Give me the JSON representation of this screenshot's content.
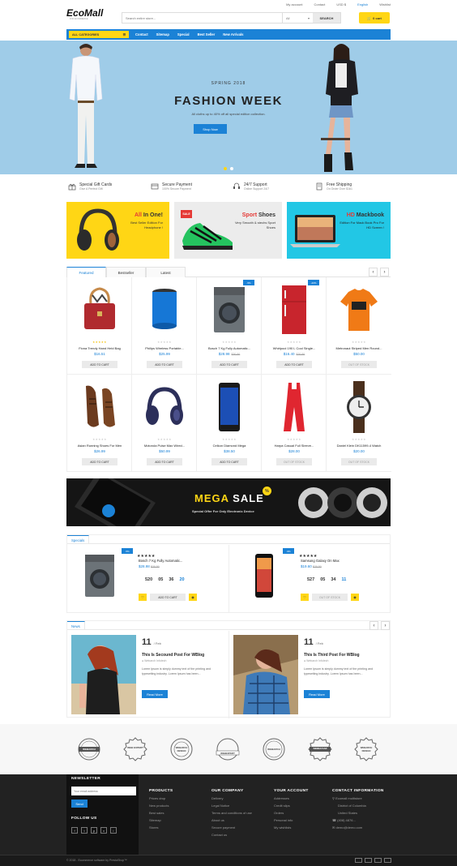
{
  "top_links": [
    "My account",
    "Contact",
    "USD $",
    "English",
    "Wishlist"
  ],
  "logo": {
    "text": "EcoMall",
    "sub": "FOR ECOMMERCE"
  },
  "search": {
    "placeholder": "Search entire store...",
    "category": "All",
    "button": "SEARCH"
  },
  "cart": {
    "label": "0 cart"
  },
  "nav": {
    "all_categories": "ALL CATEGORIES",
    "links": [
      "Contact",
      "Sitemap",
      "Special",
      "Best Seller",
      "New Arrivals"
    ]
  },
  "hero": {
    "subtitle": "SPRING 2018",
    "title": "FASHION WEEK",
    "desc": "All cloths up to 40% off all special edition collection.",
    "button": "Shop Now"
  },
  "features": [
    {
      "title": "Special Gift Cards",
      "sub": "Give A Perfect Gift"
    },
    {
      "title": "Secure Payment",
      "sub": "100% Secure Payment"
    },
    {
      "title": "24/7 Support",
      "sub": "Online Support 24/7"
    },
    {
      "title": "Free Shipping",
      "sub": "On Order Over $161"
    }
  ],
  "banners": [
    {
      "title_a": "All",
      "title_b": "In One!",
      "sub": "Best Seller Edition For Headphone !"
    },
    {
      "title_a": "Sport",
      "title_b": "Shoes",
      "sub": "Very Smooth & stechs Sport Shoes",
      "badge": "SALE"
    },
    {
      "title_a": "HD",
      "title_b": "Mackbook",
      "sub": "Edition For Mack Book Pro For HD Screen !"
    }
  ],
  "tabs": [
    "Featured",
    "Bestseller",
    "Latest"
  ],
  "arrows": {
    "prev": "‹",
    "next": "›"
  },
  "products_row1": [
    {
      "name": "Fiona Trendy Hand Held Bag",
      "price": "$16.51",
      "old": "",
      "btn": "ADD TO CART",
      "badge": ""
    },
    {
      "name": "Philips Wireless Portable...",
      "price": "$25.99",
      "old": "",
      "btn": "ADD TO CART",
      "badge": ""
    },
    {
      "name": "Bosch 7 Kg Fully Automatic...",
      "price": "$28.98",
      "old": "$30.50",
      "btn": "ADD TO CART",
      "badge": "-5%"
    },
    {
      "name": "Whirlpool 190 L Cool Single...",
      "price": "$16.40",
      "old": "$20.50",
      "btn": "ADD TO CART",
      "badge": "-20%"
    },
    {
      "name": "Metronaut Striped Men Round...",
      "price": "$50.00",
      "old": "",
      "btn": "OUT OF STOCK",
      "badge": ""
    }
  ],
  "products_row2": [
    {
      "name": "Asian Running Shoes For Men",
      "price": "$26.99",
      "old": "",
      "btn": "ADD TO CART"
    },
    {
      "name": "Motorola Pulse Max Wired...",
      "price": "$50.99",
      "old": "",
      "btn": "ADD TO CART"
    },
    {
      "name": "Celkon Diamond Mega",
      "price": "$38.50",
      "old": "",
      "btn": "ADD TO CART"
    },
    {
      "name": "Harpa Casual Full Sleeve...",
      "price": "$28.00",
      "old": "",
      "btn": "OUT OF STOCK"
    },
    {
      "name": "Daniel Klein DK11599-4 Watch",
      "price": "$20.00",
      "old": "",
      "btn": "OUT OF STOCK"
    }
  ],
  "stars": "★★★★★",
  "mega": {
    "title_a": "MEGA",
    "title_b": "SALE",
    "sub": "Special Offer For Only Electronic Device",
    "badge": "%"
  },
  "specials": {
    "tab": "Specials",
    "items": [
      {
        "badge": "-5%",
        "name": "Bosch 7 Kg Fully Automatic...",
        "price": "$28.98",
        "old": "$30.50",
        "countdown": [
          "520",
          "05",
          "36",
          "20"
        ],
        "btn": "ADD TO CART"
      },
      {
        "badge": "-9%",
        "name": "Samsung Galaxy On Max",
        "price": "$19.60",
        "old": "$20.50",
        "countdown": [
          "527",
          "05",
          "34",
          "11"
        ],
        "btn": "OUT OF STOCK"
      }
    ]
  },
  "news": {
    "tab": "News",
    "posts": [
      {
        "day": "11",
        "mon": "/ Feb",
        "title": "This Is Secound Post For WBlog",
        "by": "Webarch Infotech",
        "excerpt": "Lorem Ipsum is simply dummy text of the printing and typesetting industry. Lorem Ipsum has been...",
        "btn": "Read More"
      },
      {
        "day": "11",
        "mon": "/ Feb",
        "title": "This Is Third Post For WBlog",
        "by": "Webarch Infotech",
        "excerpt": "Lorem Ipsum is simply dummy text of the printing and typesetting industry. Lorem Ipsum has been...",
        "btn": "Read More"
      }
    ]
  },
  "brands": [
    "WEBARCH",
    "WEB EXPERT",
    "WEBARCH DESIGN",
    "WEBEXPERT",
    "WEBARCH",
    "WEBBAZAAR",
    "WEBARCH DESIGN"
  ],
  "footer": {
    "newsletter": {
      "title": "NEWSLETTER",
      "placeholder": "Your email address",
      "btn": "Send",
      "follow": "FOLLOW US",
      "social": [
        "f",
        "t",
        "p",
        "v",
        "i"
      ]
    },
    "products": {
      "title": "PRODUCTS",
      "links": [
        "Prices drop",
        "New products",
        "Best sales",
        "Sitemap",
        "Stores"
      ]
    },
    "company": {
      "title": "OUR COMPANY",
      "links": [
        "Delivery",
        "Legal Notice",
        "Terms and conditions of use",
        "About us",
        "Secure payment",
        "Contact us"
      ]
    },
    "account": {
      "title": "YOUR ACCOUNT",
      "links": [
        "Addresses",
        "Credit slips",
        "Orders",
        "Personal info",
        "My wishlists"
      ]
    },
    "contact": {
      "title": "CONTACT INFORMATION",
      "lines": [
        "Ecomall multistore",
        "District of Columbia",
        "United States",
        "(408) 4876...",
        "demo@demo.com"
      ]
    },
    "copyright": "© 2018 - Ecommerce software by PrestaShop™"
  },
  "colors": {
    "accent": "#1b82d6",
    "yellow": "#ffd615",
    "hero_bg": "#9fcce8"
  }
}
